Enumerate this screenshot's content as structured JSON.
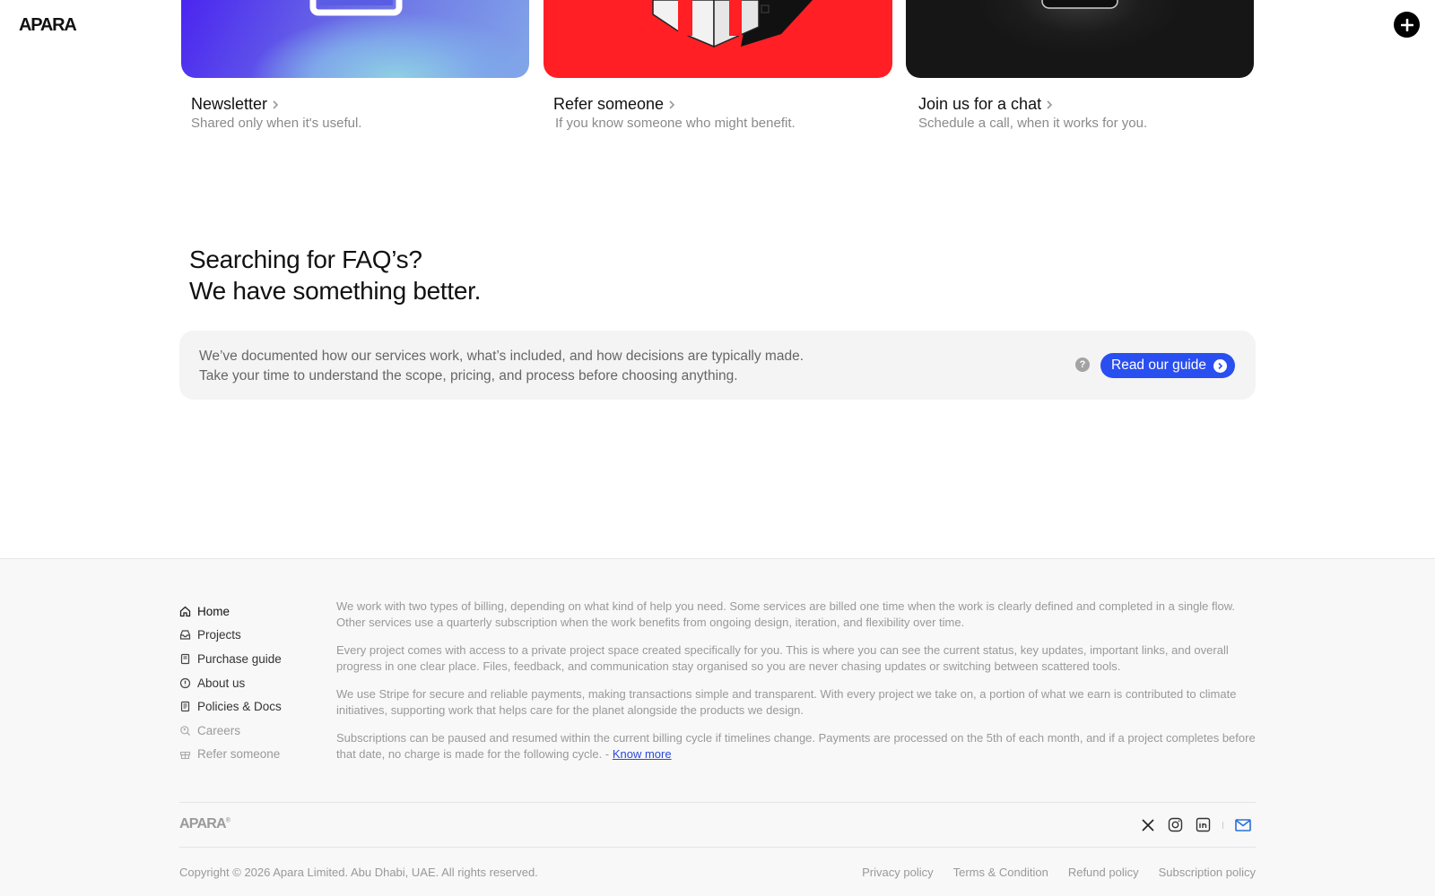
{
  "header": {
    "logo": "APARA",
    "add_icon": "plus-circle-icon"
  },
  "cards": [
    {
      "title": "Newsletter",
      "subtitle": "Shared only when it's useful.",
      "icon": "chevron-right-icon"
    },
    {
      "title": "Refer someone",
      "subtitle": "If you know someone who might benefit.",
      "icon": "chevron-right-icon"
    },
    {
      "title": "Join us for a chat",
      "subtitle": "Schedule a call, when it works for you.",
      "icon": "chevron-right-icon"
    }
  ],
  "faq": {
    "heading_line1": "Searching for FAQ’s?",
    "heading_line2": "We have something better.",
    "body_line1": "We’ve documented how our services work, what’s included, and how decisions are typically made.",
    "body_line2": "Take your time to understand the scope, pricing, and process before choosing anything.",
    "help_glyph": "?",
    "button_label": "Read our guide"
  },
  "footer": {
    "nav": [
      {
        "label": "Home",
        "icon": "home-icon",
        "state": "active"
      },
      {
        "label": "Projects",
        "icon": "inbox-icon",
        "state": "normal"
      },
      {
        "label": "Purchase guide",
        "icon": "book-icon",
        "state": "normal"
      },
      {
        "label": "About us",
        "icon": "info-icon",
        "state": "normal"
      },
      {
        "label": "Policies & Docs",
        "icon": "document-icon",
        "state": "normal"
      },
      {
        "label": "Careers",
        "icon": "search-person-icon",
        "state": "muted"
      },
      {
        "label": "Refer someone",
        "icon": "gift-icon",
        "state": "muted"
      }
    ],
    "paragraphs": [
      "We work with two types of billing, depending on what kind of help you need. Some services are billed one time when the work is clearly defined and completed in a single flow. Other services use a quarterly subscription when the work benefits from ongoing design, iteration, and flexibility over time.",
      "Every project comes with access to a private project space created specifically for you. This is where you can see the current status, key updates, important links, and overall progress in one clear place. Files, feedback, and communication stay organised so you are never chasing updates or switching between scattered tools.",
      "We use Stripe for secure and reliable payments, making transactions simple and transparent. With every project we take on, a portion of what we earn is contributed to climate initiatives, supporting work that helps care for the planet alongside the products we design."
    ],
    "last_paragraph": "Subscriptions can be paused and resumed within the current billing cycle if timelines change. Payments are processed on the 5th of each month, and if a project completes before that date, no charge is made for the following cycle. - ",
    "know_more": "Know more",
    "logo": "APARA",
    "logo_mark": "®",
    "socials": [
      "x-icon",
      "instagram-icon",
      "linkedin-icon",
      "mail-icon"
    ],
    "copyright": "Copyright © 2026 Apara Limited. Abu Dhabi, UAE. All rights reserved.",
    "policies": [
      "Privacy policy",
      "Terms & Condition",
      "Refund policy",
      "Subscription policy"
    ]
  },
  "colors": {
    "accent": "#2a4ff0",
    "refer_card": "#ff1f24",
    "chat_card": "#1a1a1a",
    "mail_icon": "#2a6fd8"
  }
}
